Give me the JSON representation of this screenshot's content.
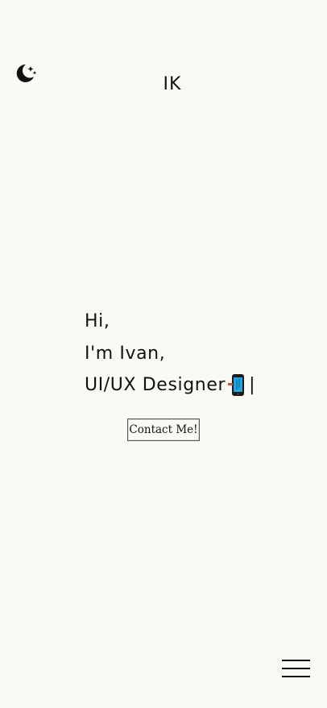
{
  "header": {
    "theme_toggle_icon": "moon-stars-icon",
    "logo": "IK"
  },
  "hero": {
    "greeting": "Hi,",
    "intro": "I'm Ivan,",
    "role": "UI/UX Designer",
    "role_icon": "mobile-phone-icon",
    "cursor": "|"
  },
  "contact_button": {
    "label": "Contact Me!"
  },
  "menu": {
    "icon": "hamburger-menu-icon"
  }
}
